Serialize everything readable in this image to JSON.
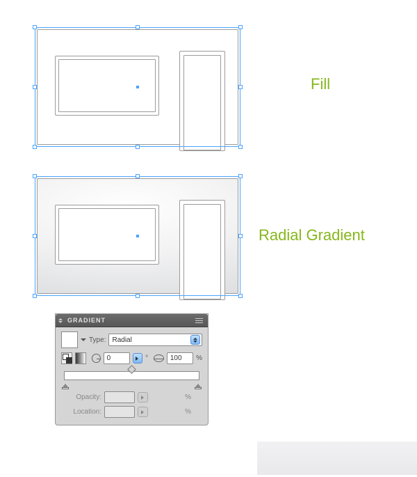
{
  "annotations": {
    "fill": "Fill",
    "radial": "Radial Gradient"
  },
  "panel": {
    "title": "GRADIENT",
    "type_label": "Type:",
    "type_value": "Radial",
    "angle_value": "0",
    "angle_unit": "°",
    "aspect_value": "100",
    "aspect_unit": "%",
    "opacity_label": "Opacity:",
    "opacity_unit": "%",
    "location_label": "Location:",
    "location_unit": "%"
  },
  "icons": {
    "collapse": "collapse-icon",
    "menu": "menu-icon",
    "swap": "swap-fill-stroke-icon",
    "reverse": "reverse-gradient-icon",
    "angle": "angle-icon",
    "aspect": "aspect-ratio-icon"
  },
  "chart_data": {
    "type": "diagram",
    "figures": [
      {
        "name": "building-outline-fill-white",
        "selected": true,
        "fill": "solid-white"
      },
      {
        "name": "building-outline-fill-radial-gradient",
        "selected": true,
        "fill": "radial-white-to-gray"
      }
    ],
    "gradient": {
      "type": "Radial",
      "angle": 0,
      "aspect_ratio_percent": 100,
      "stops": [
        {
          "location": 0,
          "color": "#ffffff"
        },
        {
          "location": 100,
          "color": "#d7d8da"
        }
      ]
    }
  }
}
